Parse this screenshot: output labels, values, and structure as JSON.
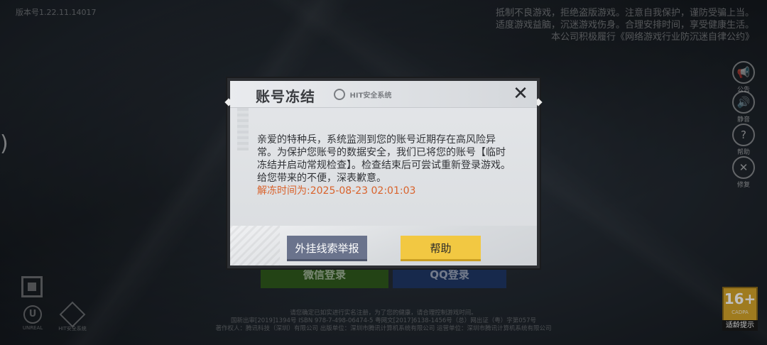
{
  "background": {
    "version_text": "版本号1.22.11.14017",
    "notice_lines": [
      "抵制不良游戏，拒绝盗版游戏。注意自我保护，谨防受骗上当。",
      "适度游戏益脑，沉迷游戏伤身。合理安排时间，享受健康生活。",
      "本公司积极履行《网络游戏行业防沉迷自律公约》"
    ],
    "left_glyph": ")",
    "side_buttons": [
      {
        "icon": "megaphone-icon",
        "glyph": "📢",
        "label": "公告"
      },
      {
        "icon": "volume-icon",
        "glyph": "🔊",
        "label": "静音"
      },
      {
        "icon": "help-icon",
        "glyph": "?",
        "label": "帮助"
      },
      {
        "icon": "repair-icon",
        "glyph": "✕",
        "label": "修复"
      }
    ],
    "login_wechat_label": "微信登录",
    "login_qq_label": "QQ登录",
    "footer_lines": [
      "请您确定已如实进行实名注册，为了您的健康，请合理控制游戏时间。",
      "国新出审[2019]1394号  ISBN 978-7-498-06474-5  粤网文[2017]6138-1456号（总）网出证（粤）字第057号",
      "著作权人：腾讯科技（深圳）有限公司  出版单位：深圳市腾讯计算机系统有限公司  运营单位：深圳市腾讯计算机系统有限公司"
    ],
    "unreal_label": "UNREAL",
    "hit_small_label": "HIT安全系统",
    "age_badge": {
      "number": "16+",
      "sub": "CADPA",
      "tip": "适龄提示"
    }
  },
  "dialog": {
    "title": "账号冻结",
    "logo_text": "HIT安全系统",
    "close_glyph": "✕",
    "message": "亲爱的特种兵，系统监测到您的账号近期存在高风险异常。为保护您账号的数据安全，我们已将您的账号【临时冻结并启动常规检查】。检查结束后可尝试重新登录游戏。给您带来的不便，深表歉意。",
    "unfreeze_text": "解冻时间为:2025-08-23 02:01:03",
    "report_button_label": "外挂线索举报",
    "help_button_label": "帮助"
  },
  "colors": {
    "unfreeze_text": "#d9622b",
    "report_button": "#6a738c",
    "help_button": "#f2c842",
    "age_badge": "#d4a42a"
  }
}
